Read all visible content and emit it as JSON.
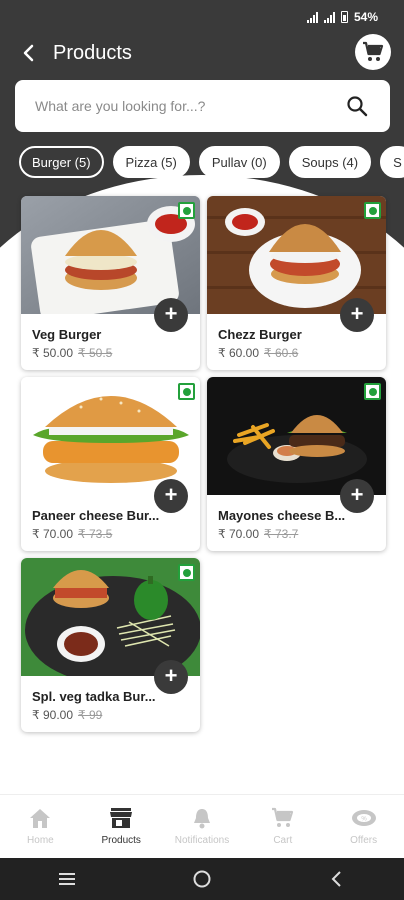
{
  "statusbar": {
    "battery_text": "54%"
  },
  "header": {
    "title": "Products"
  },
  "search": {
    "placeholder": "What are you looking for...?"
  },
  "categories": [
    {
      "label": "Burger (5)",
      "active": true
    },
    {
      "label": "Pizza (5)",
      "active": false
    },
    {
      "label": "Pullav (0)",
      "active": false
    },
    {
      "label": "Soups (4)",
      "active": false
    },
    {
      "label": "S",
      "active": false
    }
  ],
  "products": [
    {
      "name": "Veg Burger",
      "price": "₹ 50.00",
      "old_price": "₹ 50.5",
      "veg": true,
      "add_label": "+"
    },
    {
      "name": "Chezz Burger",
      "price": "₹ 60.00",
      "old_price": "₹ 60.6",
      "veg": true,
      "add_label": "+"
    },
    {
      "name": "Paneer cheese Bur...",
      "price": "₹ 70.00",
      "old_price": "₹ 73.5",
      "veg": true,
      "add_label": "+"
    },
    {
      "name": "Mayones cheese B...",
      "price": "₹ 70.00",
      "old_price": "₹ 73.7",
      "veg": true,
      "add_label": "+"
    },
    {
      "name": "Spl. veg tadka Bur...",
      "price": "₹ 90.00",
      "old_price": "₹ 99",
      "veg": true,
      "add_label": "+"
    }
  ],
  "bottom_nav": [
    {
      "label": "Home",
      "icon": "home-icon",
      "active": false
    },
    {
      "label": "Products",
      "icon": "store-icon",
      "active": true
    },
    {
      "label": "Notifications",
      "icon": "bell-icon",
      "active": false
    },
    {
      "label": "Cart",
      "icon": "cart-icon",
      "active": false
    },
    {
      "label": "Offers",
      "icon": "offers-icon",
      "active": false
    }
  ],
  "colors": {
    "header": "#3a3a3a",
    "veg_green": "#23a03b",
    "nav_inactive": "#c6c6c6"
  }
}
